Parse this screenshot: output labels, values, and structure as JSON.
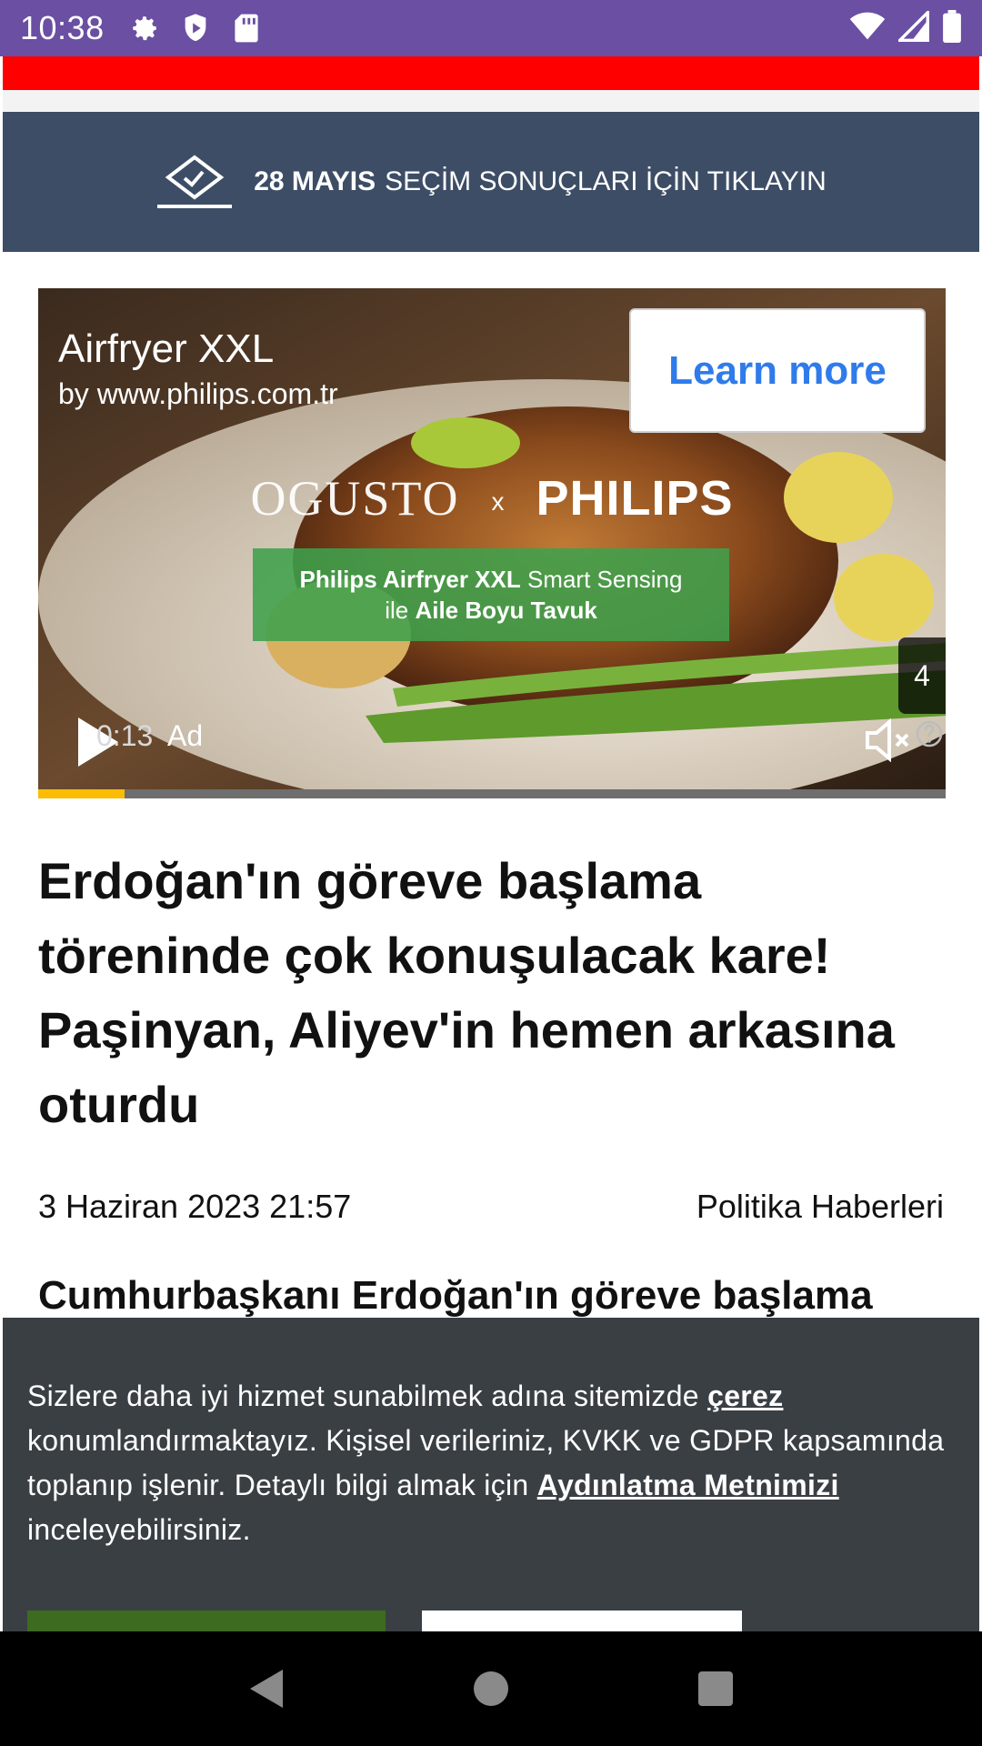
{
  "status_bar": {
    "time": "10:38",
    "icons_left": [
      "gear-icon",
      "shield-icon",
      "sd-card-icon"
    ],
    "icons_right": [
      "wifi-icon",
      "signal-icon",
      "battery-icon"
    ]
  },
  "election_banner": {
    "date_text": "28 MAYIS",
    "label": "SEÇİM SONUÇLARI İÇİN TIKLAYIN"
  },
  "ad": {
    "title": "Airfryer XXL",
    "advertiser": "by www.philips.com.tr",
    "cta_label": "Learn more",
    "brand_left": "OGUSTO",
    "brand_x": "x",
    "brand_right": "PHILIPS",
    "overlay_line1_bold": "Philips Airfryer XXL",
    "overlay_line1_rest": " Smart Sensing",
    "overlay_line2_pre": "ile ",
    "overlay_line2_bold": "Aile Boyu Tavuk",
    "skip_count": "4",
    "timer": "0:13",
    "ad_label": "Ad",
    "progress_fraction": 0.095,
    "colors": {
      "cta_text": "#2f7bea",
      "progress": "#fbbc04"
    }
  },
  "article": {
    "headline": "Erdoğan'ın göreve başlama töreninde çok konuşulacak kare! Paşinyan, Aliyev'in hemen arkasına oturdu",
    "date": "3 Haziran 2023 21:57",
    "category": "Politika Haberleri",
    "lead": "Cumhurbaşkanı Erdoğan'ın göreve başlama"
  },
  "cookie": {
    "text_1": "Sizlere daha iyi hizmet sunabilmek adına sitemizde ",
    "link_1": "çerez",
    "text_2": " konumlandırmaktayız. Kişisel verileriniz, KVKK ve GDPR kapsamında toplanıp işlenir. Detaylı bilgi almak için ",
    "link_2": "Aydınlatma Metnimizi",
    "text_3": " inceleyebilirsiniz."
  },
  "nav": {
    "icons": [
      "back-icon",
      "home-icon",
      "recents-icon"
    ]
  },
  "colors": {
    "status_bar": "#6a4fa3",
    "red_bar": "#ff0000",
    "election_banner": "#3d4d66",
    "cookie_banner": "#3a3f44"
  }
}
